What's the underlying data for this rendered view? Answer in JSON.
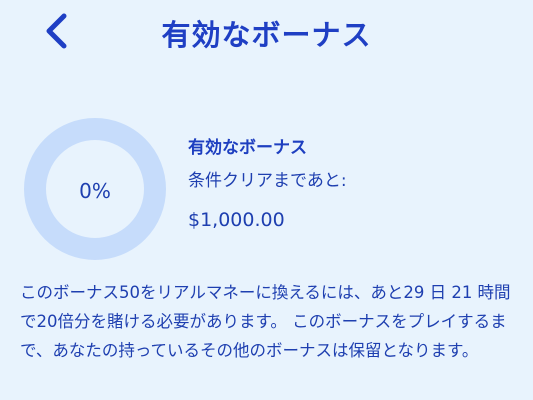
{
  "header": {
    "title": "有効なボーナス",
    "back_icon": "chevron-left-icon"
  },
  "bonus": {
    "progress_value": 0,
    "progress_label": "0%",
    "name": "有効なボーナス",
    "remaining_label": "条件クリアまであと:",
    "remaining_amount": "$1,000.00",
    "description": "このボーナス50をリアルマネーに換えるには、あと29 日 21 時間で20倍分を賭ける必要があります。 このボーナスをプレイするまで、あなたの持っているその他のボーナスは保留となります。"
  },
  "colors": {
    "background": "#e8f3fd",
    "accent": "#1f3fc4",
    "ring_track": "#c6dcfb"
  }
}
